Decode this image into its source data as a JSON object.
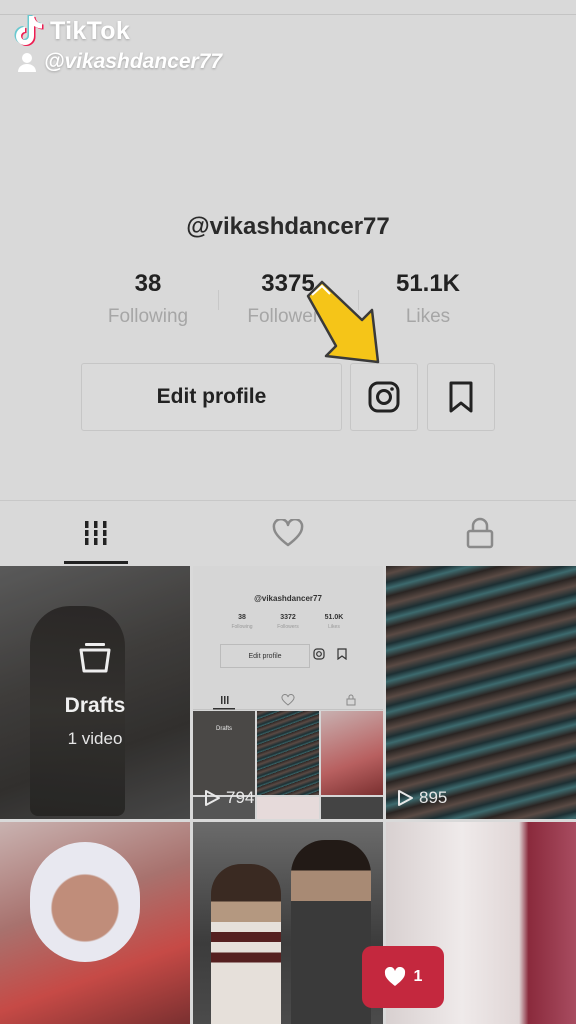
{
  "watermark": {
    "brand": "TikTok",
    "handle": "@vikashdancer77"
  },
  "profile": {
    "username": "@vikashdancer77",
    "stats": [
      {
        "value": "38",
        "label": "Following"
      },
      {
        "value": "3375",
        "label": "Followers"
      },
      {
        "value": "51.1K",
        "label": "Likes"
      }
    ],
    "edit_profile_label": "Edit profile"
  },
  "icons": {
    "instagram": "instagram-icon",
    "bookmark": "bookmark-icon",
    "videos_tab": "grid-icon",
    "liked_tab": "heart-icon",
    "private_tab": "lock-icon"
  },
  "annotation_arrow_color": "#f5c518",
  "grid": {
    "drafts": {
      "title": "Drafts",
      "count": "1 video"
    },
    "mini_screenshot": {
      "username": "@vikashdancer77",
      "stats": [
        {
          "value": "38",
          "label": "Following"
        },
        {
          "value": "3372",
          "label": "Followers"
        },
        {
          "value": "51.0K",
          "label": "Likes"
        }
      ],
      "edit_profile_label": "Edit profile",
      "drafts_label": "Drafts"
    },
    "plays": [
      "794",
      "895"
    ]
  },
  "likes_notification": {
    "count": "1",
    "color": "#c4283e"
  }
}
